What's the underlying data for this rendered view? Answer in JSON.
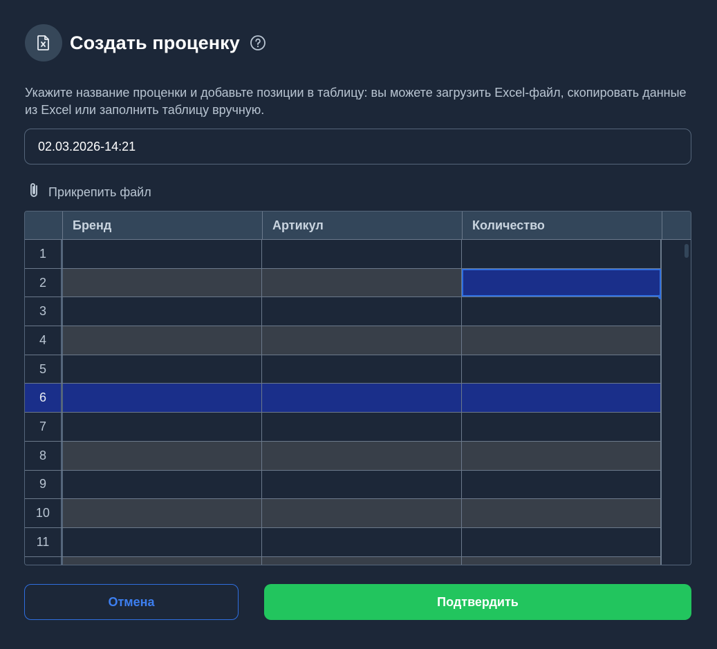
{
  "dialog": {
    "title": "Создать проценку",
    "description": "Укажите название проценки и добавьте позиции в таблицу: вы можете загрузить Excel-файл, скопировать данные из Excel или заполнить таблицу вручную.",
    "name_value": "02.03.2026-14:21",
    "attach_label": "Прикрепить файл",
    "icons": {
      "header": "excel-file-icon",
      "help": "question-circle-icon",
      "attach": "paperclip-icon"
    }
  },
  "sheet": {
    "columns": [
      "Бренд",
      "Артикул",
      "Количество"
    ],
    "rows": [
      "1",
      "2",
      "3",
      "4",
      "5",
      "6",
      "7",
      "8",
      "9",
      "10",
      "11"
    ],
    "selected_row": "6",
    "active_cell": {
      "row": "2",
      "column": "Количество"
    }
  },
  "buttons": {
    "cancel": "Отмена",
    "confirm": "Подтвердить"
  },
  "colors": {
    "background": "#1c2738",
    "accent_blue": "#2f6fe0",
    "selection": "#1a2f8a",
    "confirm_green": "#22c55e"
  }
}
